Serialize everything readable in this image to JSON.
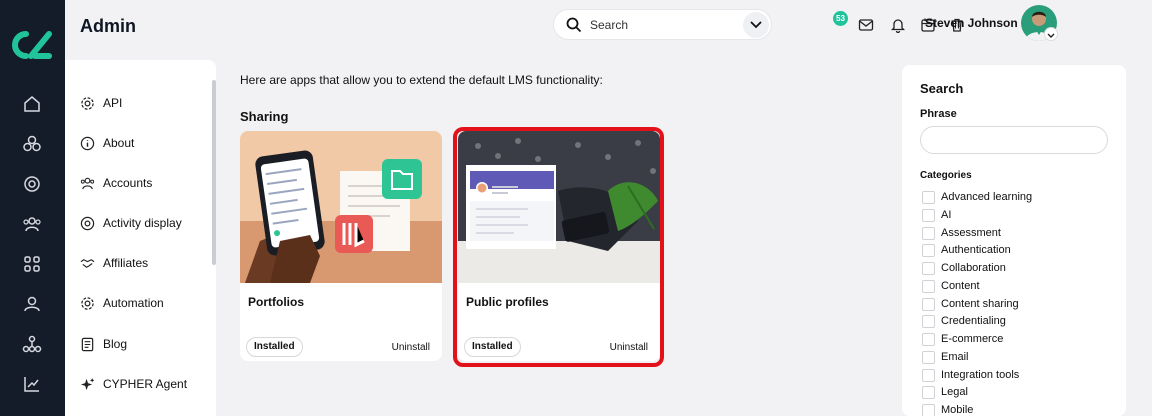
{
  "header": {
    "title": "Admin",
    "search_placeholder": "Search",
    "notification_count": "53",
    "user_name": "Steven Johnson"
  },
  "rail": {
    "icons": [
      "home-icon",
      "courses-icon",
      "target-icon",
      "users-icon",
      "apps-icon",
      "user-icon",
      "hierarchy-icon",
      "reports-icon"
    ]
  },
  "submenu": {
    "items": [
      {
        "label": "API",
        "icon": "gear-icon"
      },
      {
        "label": "About",
        "icon": "info-icon"
      },
      {
        "label": "Accounts",
        "icon": "accounts-icon"
      },
      {
        "label": "Activity display",
        "icon": "activity-icon"
      },
      {
        "label": "Affiliates",
        "icon": "handshake-icon"
      },
      {
        "label": "Automation",
        "icon": "gear-icon"
      },
      {
        "label": "Blog",
        "icon": "blog-icon"
      },
      {
        "label": "CYPHER Agent",
        "icon": "sparkle-icon"
      }
    ]
  },
  "main": {
    "intro": "Here are apps that allow you to extend the default LMS functionality:",
    "section_title": "Sharing",
    "cards": [
      {
        "title": "Portfolios",
        "status": "Installed",
        "action": "Uninstall"
      },
      {
        "title": "Public profiles",
        "status": "Installed",
        "action": "Uninstall"
      }
    ]
  },
  "panel": {
    "title": "Search",
    "phrase_label": "Phrase",
    "categories_label": "Categories",
    "categories": [
      "Advanced learning",
      "AI",
      "Assessment",
      "Authentication",
      "Collaboration",
      "Content",
      "Content sharing",
      "Credentialing",
      "E-commerce",
      "Email",
      "Integration tools",
      "Legal",
      "Mobile"
    ]
  },
  "colors": {
    "rail": "#141b29",
    "accent": "#21c49a",
    "highlight": "#e3121a"
  }
}
